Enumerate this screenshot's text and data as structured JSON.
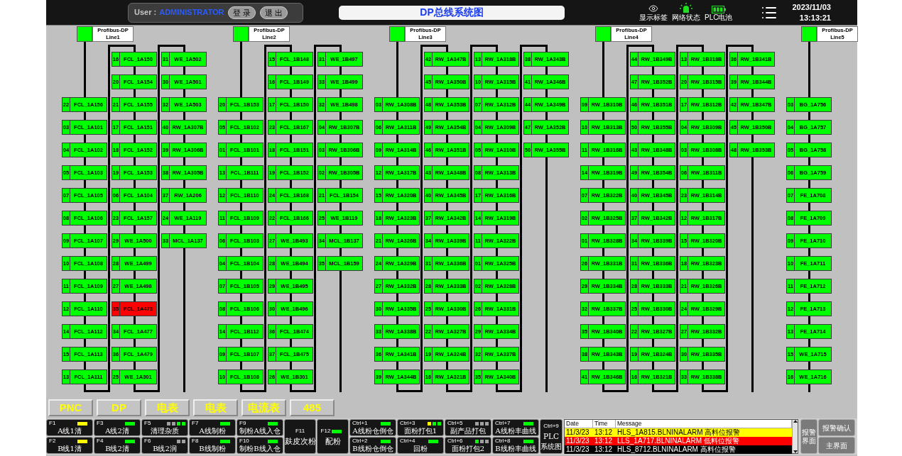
{
  "top_bar": {
    "user_label": "User :",
    "user_name": "ADMINISTRATOR",
    "buttons": [
      "登 录",
      "退 出"
    ],
    "title": "DP总线系统图",
    "status_icons": [
      {
        "kind": "eye",
        "label": "显示标签"
      },
      {
        "kind": "beacon",
        "label": "网络状态"
      },
      {
        "kind": "battery",
        "label": "PLC电池"
      }
    ],
    "date": "2023/11/03",
    "time": "13:13:21"
  },
  "lines": [
    {
      "title": "Profibus-DP",
      "name": "Line1",
      "columns": [
        {
          "kind": "trunk",
          "devices": [
            {
              "addr": "22",
              "tag": "FCL_1A156",
              "fault": false
            },
            {
              "addr": "03",
              "tag": "FCL_1A101",
              "fault": false
            },
            {
              "addr": "04",
              "tag": "FCL_1A102",
              "fault": false
            },
            {
              "addr": "05",
              "tag": "FCL_1A103",
              "fault": false
            },
            {
              "addr": "07",
              "tag": "FCL_1A105",
              "fault": false
            },
            {
              "addr": "08",
              "tag": "FCL_1A106",
              "fault": false
            },
            {
              "addr": "09",
              "tag": "FCL_1A107",
              "fault": false
            },
            {
              "addr": "10",
              "tag": "FCL_1A108",
              "fault": false
            },
            {
              "addr": "11",
              "tag": "FCL_1A109",
              "fault": false
            },
            {
              "addr": "12",
              "tag": "FCL_1A110",
              "fault": false
            },
            {
              "addr": "14",
              "tag": "FCL_1A112",
              "fault": false
            },
            {
              "addr": "15",
              "tag": "FCL_1A113",
              "fault": false
            },
            {
              "addr": "13",
              "tag": "FCL_1A111",
              "fault": false
            }
          ]
        },
        {
          "kind": "branch",
          "devices": [
            {
              "addr": "16",
              "tag": "FCL_1A150",
              "fault": false
            },
            {
              "addr": "20",
              "tag": "FCL_1A154",
              "fault": false
            },
            {
              "addr": "21",
              "tag": "FCL_1A155",
              "fault": false
            },
            {
              "addr": "17",
              "tag": "FCL_1A151",
              "fault": false
            },
            {
              "addr": "18",
              "tag": "FCL_1A152",
              "fault": false
            },
            {
              "addr": "19",
              "tag": "FCL_1A153",
              "fault": false
            },
            {
              "addr": "06",
              "tag": "FCL_1A104",
              "fault": false
            },
            {
              "addr": "23",
              "tag": "FCL_1A157",
              "fault": false
            },
            {
              "addr": "29",
              "tag": "WE_1A500",
              "fault": false
            },
            {
              "addr": "28",
              "tag": "WE_1A499",
              "fault": false
            },
            {
              "addr": "27",
              "tag": "WE_1A498",
              "fault": false
            },
            {
              "addr": "35",
              "tag": "FCL_1A478",
              "fault": true
            },
            {
              "addr": "34",
              "tag": "FCL_1A477",
              "fault": false
            },
            {
              "addr": "36",
              "tag": "FCL_1A479",
              "fault": false
            },
            {
              "addr": "25",
              "tag": "WE_1A301",
              "fault": false
            }
          ]
        },
        {
          "kind": "branch",
          "devices": [
            {
              "addr": "31",
              "tag": "WE_1A502",
              "fault": false
            },
            {
              "addr": "30",
              "tag": "WE_1A501",
              "fault": false
            },
            {
              "addr": "32",
              "tag": "WE_1A503",
              "fault": false
            },
            {
              "addr": "40",
              "tag": "RW_1A307B",
              "fault": false
            },
            {
              "addr": "39",
              "tag": "RW_1A306B",
              "fault": false
            },
            {
              "addr": "38",
              "tag": "RW_1A305B",
              "fault": false
            },
            {
              "addr": "37",
              "tag": "RW_1A206",
              "fault": false
            },
            {
              "addr": "24",
              "tag": "WE_1A119",
              "fault": false
            },
            {
              "addr": "33",
              "tag": "MCL_1A137",
              "fault": false
            }
          ]
        }
      ]
    },
    {
      "title": "Profibus-DP",
      "name": "Line2",
      "columns": [
        {
          "kind": "trunk",
          "devices": [
            {
              "addr": "20",
              "tag": "FCL_1B153",
              "fault": false
            },
            {
              "addr": "05",
              "tag": "FCL_1B102",
              "fault": false
            },
            {
              "addr": "01",
              "tag": "FCL_1B101",
              "fault": false
            },
            {
              "addr": "13",
              "tag": "FCL_1B111",
              "fault": false
            },
            {
              "addr": "12",
              "tag": "FCL_1B110",
              "fault": false
            },
            {
              "addr": "11",
              "tag": "FCL_1B109",
              "fault": false
            },
            {
              "addr": "06",
              "tag": "FCL_1B103",
              "fault": false
            },
            {
              "addr": "04",
              "tag": "FCL_1B104",
              "fault": false
            },
            {
              "addr": "07",
              "tag": "FCL_1B105",
              "fault": false
            },
            {
              "addr": "08",
              "tag": "FCL_1B106",
              "fault": false
            },
            {
              "addr": "14",
              "tag": "FCL_1B112",
              "fault": false
            },
            {
              "addr": "09",
              "tag": "FCL_1B107",
              "fault": false
            },
            {
              "addr": "10",
              "tag": "FCL_1B108",
              "fault": false
            }
          ]
        },
        {
          "kind": "branch",
          "devices": [
            {
              "addr": "15",
              "tag": "FCL_1B148",
              "fault": false
            },
            {
              "addr": "16",
              "tag": "FCL_1B149",
              "fault": false
            },
            {
              "addr": "17",
              "tag": "FCL_1B150",
              "fault": false
            },
            {
              "addr": "23",
              "tag": "FCL_1B167",
              "fault": false
            },
            {
              "addr": "18",
              "tag": "FCL_1B151",
              "fault": false
            },
            {
              "addr": "19",
              "tag": "FCL_1B152",
              "fault": false
            },
            {
              "addr": "24",
              "tag": "FCL_1B168",
              "fault": false
            },
            {
              "addr": "22",
              "tag": "FCL_1B166",
              "fault": false
            },
            {
              "addr": "27",
              "tag": "WE_1B493",
              "fault": false
            },
            {
              "addr": "28",
              "tag": "WE_1B494",
              "fault": false
            },
            {
              "addr": "29",
              "tag": "WE_1B495",
              "fault": false
            },
            {
              "addr": "30",
              "tag": "WE_1B496",
              "fault": false
            },
            {
              "addr": "36",
              "tag": "FCL_1B474",
              "fault": false
            },
            {
              "addr": "37",
              "tag": "FCL_1B475",
              "fault": false
            },
            {
              "addr": "26",
              "tag": "WE_1B301",
              "fault": false
            }
          ]
        },
        {
          "kind": "branch",
          "devices": [
            {
              "addr": "31",
              "tag": "WE_1B497",
              "fault": false
            },
            {
              "addr": "33",
              "tag": "WE_1B499",
              "fault": false
            },
            {
              "addr": "32",
              "tag": "WE_1B498",
              "fault": false
            },
            {
              "addr": "04",
              "tag": "RW_1B307B",
              "fault": false
            },
            {
              "addr": "03",
              "tag": "RW_1B306B",
              "fault": false
            },
            {
              "addr": "02",
              "tag": "RW_1B305B",
              "fault": false
            },
            {
              "addr": "21",
              "tag": "FCL_1B154",
              "fault": false
            },
            {
              "addr": "25",
              "tag": "WE_1B119",
              "fault": false
            },
            {
              "addr": "34",
              "tag": "MCL_1B137",
              "fault": false
            },
            {
              "addr": "35",
              "tag": "MCL_1B159",
              "fault": false
            }
          ]
        }
      ]
    },
    {
      "title": "Profibus-DP",
      "name": "Line3",
      "columns": [
        {
          "kind": "trunk",
          "devices": [
            {
              "addr": "03",
              "tag": "RW_1A308B",
              "fault": false
            },
            {
              "addr": "06",
              "tag": "RW_1A311B",
              "fault": false
            },
            {
              "addr": "09",
              "tag": "RW_1A314B",
              "fault": false
            },
            {
              "addr": "12",
              "tag": "RW_1A317B",
              "fault": false
            },
            {
              "addr": "15",
              "tag": "RW_1A320B",
              "fault": false
            },
            {
              "addr": "18",
              "tag": "RW_1A323B",
              "fault": false
            },
            {
              "addr": "21",
              "tag": "RW_1A326B",
              "fault": false
            },
            {
              "addr": "24",
              "tag": "RW_1A329B",
              "fault": false
            },
            {
              "addr": "27",
              "tag": "RW_1A332B",
              "fault": false
            },
            {
              "addr": "30",
              "tag": "RW_1A335B",
              "fault": false
            },
            {
              "addr": "33",
              "tag": "RW_1A338B",
              "fault": false
            },
            {
              "addr": "36",
              "tag": "RW_1A341B",
              "fault": false
            },
            {
              "addr": "39",
              "tag": "RW_1A344B",
              "fault": false
            }
          ]
        },
        {
          "kind": "branch",
          "devices": [
            {
              "addr": "42",
              "tag": "RW_1A347B",
              "fault": false
            },
            {
              "addr": "45",
              "tag": "RW_1A350B",
              "fault": false
            },
            {
              "addr": "48",
              "tag": "RW_1A353B",
              "fault": false
            },
            {
              "addr": "49",
              "tag": "RW_1A354B",
              "fault": false
            },
            {
              "addr": "46",
              "tag": "RW_1A351B",
              "fault": false
            },
            {
              "addr": "43",
              "tag": "RW_1A348B",
              "fault": false
            },
            {
              "addr": "40",
              "tag": "RW_1A345B",
              "fault": false
            },
            {
              "addr": "37",
              "tag": "RW_1A342B",
              "fault": false
            },
            {
              "addr": "34",
              "tag": "RW_1A339B",
              "fault": false
            },
            {
              "addr": "31",
              "tag": "RW_1A336B",
              "fault": false
            },
            {
              "addr": "28",
              "tag": "RW_1A333B",
              "fault": false
            },
            {
              "addr": "25",
              "tag": "RW_1A330B",
              "fault": false
            },
            {
              "addr": "22",
              "tag": "RW_1A327B",
              "fault": false
            },
            {
              "addr": "19",
              "tag": "RW_1A324B",
              "fault": false
            },
            {
              "addr": "16",
              "tag": "RW_1A321B",
              "fault": false
            }
          ]
        },
        {
          "kind": "branch",
          "devices": [
            {
              "addr": "13",
              "tag": "RW_1A318B",
              "fault": false
            },
            {
              "addr": "10",
              "tag": "RW_1A315B",
              "fault": false
            },
            {
              "addr": "07",
              "tag": "RW_1A312B",
              "fault": false
            },
            {
              "addr": "04",
              "tag": "RW_1A309B",
              "fault": false
            },
            {
              "addr": "05",
              "tag": "RW_1A310B",
              "fault": false
            },
            {
              "addr": "08",
              "tag": "RW_1A313B",
              "fault": false
            },
            {
              "addr": "17",
              "tag": "RW_1A316B",
              "fault": false
            },
            {
              "addr": "14",
              "tag": "RW_1A319B",
              "fault": false
            },
            {
              "addr": "11",
              "tag": "RW_1A322B",
              "fault": false
            },
            {
              "addr": "01",
              "tag": "RW_1A325B",
              "fault": false
            },
            {
              "addr": "02",
              "tag": "RW_1A328B",
              "fault": false
            },
            {
              "addr": "26",
              "tag": "RW_1A331B",
              "fault": false
            },
            {
              "addr": "29",
              "tag": "RW_1A334B",
              "fault": false
            },
            {
              "addr": "32",
              "tag": "RW_1A337B",
              "fault": false
            },
            {
              "addr": "35",
              "tag": "RW_1A340B",
              "fault": false
            }
          ]
        },
        {
          "kind": "branch",
          "devices": [
            {
              "addr": "38",
              "tag": "RW_1A343B",
              "fault": false
            },
            {
              "addr": "41",
              "tag": "RW_1A346B",
              "fault": false
            },
            {
              "addr": "44",
              "tag": "RW_1A349B",
              "fault": false
            },
            {
              "addr": "47",
              "tag": "RW_1A352B",
              "fault": false
            },
            {
              "addr": "50",
              "tag": "RW_1A355B",
              "fault": false
            }
          ]
        }
      ]
    },
    {
      "title": "Profibus-DP",
      "name": "Line4",
      "columns": [
        {
          "kind": "trunk",
          "devices": [
            {
              "addr": "09",
              "tag": "RW_1B310B",
              "fault": false
            },
            {
              "addr": "10",
              "tag": "RW_1B313B",
              "fault": false
            },
            {
              "addr": "11",
              "tag": "RW_1B316B",
              "fault": false
            },
            {
              "addr": "14",
              "tag": "RW_1B319B",
              "fault": false
            },
            {
              "addr": "07",
              "tag": "RW_1B322B",
              "fault": false
            },
            {
              "addr": "02",
              "tag": "RW_1B325B",
              "fault": false
            },
            {
              "addr": "01",
              "tag": "RW_1B328B",
              "fault": false
            },
            {
              "addr": "26",
              "tag": "RW_1B331B",
              "fault": false
            },
            {
              "addr": "29",
              "tag": "RW_1B334B",
              "fault": false
            },
            {
              "addr": "32",
              "tag": "RW_1B337B",
              "fault": false
            },
            {
              "addr": "35",
              "tag": "RW_1B340B",
              "fault": false
            },
            {
              "addr": "38",
              "tag": "RW_1B343B",
              "fault": false
            },
            {
              "addr": "41",
              "tag": "RW_1B346B",
              "fault": false
            }
          ]
        },
        {
          "kind": "branch",
          "devices": [
            {
              "addr": "44",
              "tag": "RW_1B349B",
              "fault": false
            },
            {
              "addr": "47",
              "tag": "RW_1B352B",
              "fault": false
            },
            {
              "addr": "46",
              "tag": "RW_1B351B",
              "fault": false
            },
            {
              "addr": "50",
              "tag": "RW_1B355B",
              "fault": false
            },
            {
              "addr": "43",
              "tag": "RW_1B348B",
              "fault": false
            },
            {
              "addr": "49",
              "tag": "RW_1B354B",
              "fault": false
            },
            {
              "addr": "40",
              "tag": "RW_1B345B",
              "fault": false
            },
            {
              "addr": "37",
              "tag": "RW_1B342B",
              "fault": false
            },
            {
              "addr": "34",
              "tag": "RW_1B339B",
              "fault": false
            },
            {
              "addr": "31",
              "tag": "RW_1B336B",
              "fault": false
            },
            {
              "addr": "28",
              "tag": "RW_1B333B",
              "fault": false
            },
            {
              "addr": "25",
              "tag": "RW_1B330B",
              "fault": false
            },
            {
              "addr": "22",
              "tag": "RW_1B327B",
              "fault": false
            },
            {
              "addr": "19",
              "tag": "RW_1B324B",
              "fault": false
            },
            {
              "addr": "16",
              "tag": "RW_1B321B",
              "fault": false
            }
          ]
        },
        {
          "kind": "branch",
          "devices": [
            {
              "addr": "13",
              "tag": "RW_1B318B",
              "fault": false
            },
            {
              "addr": "20",
              "tag": "RW_1B315B",
              "fault": false
            },
            {
              "addr": "17",
              "tag": "RW_1B312B",
              "fault": false
            },
            {
              "addr": "04",
              "tag": "RW_1B309B",
              "fault": false
            },
            {
              "addr": "03",
              "tag": "RW_1B308B",
              "fault": false
            },
            {
              "addr": "06",
              "tag": "RW_1B311B",
              "fault": false
            },
            {
              "addr": "23",
              "tag": "RW_1B314B",
              "fault": false
            },
            {
              "addr": "12",
              "tag": "RW_1B317B",
              "fault": false
            },
            {
              "addr": "15",
              "tag": "RW_1B320B",
              "fault": false
            },
            {
              "addr": "18",
              "tag": "RW_1B323B",
              "fault": false
            },
            {
              "addr": "21",
              "tag": "RW_1B326B",
              "fault": false
            },
            {
              "addr": "24",
              "tag": "RW_1B329B",
              "fault": false
            },
            {
              "addr": "27",
              "tag": "RW_1B332B",
              "fault": false
            },
            {
              "addr": "30",
              "tag": "RW_1B335B",
              "fault": false
            },
            {
              "addr": "33",
              "tag": "RW_1B338B",
              "fault": false
            }
          ]
        },
        {
          "kind": "branch",
          "devices": [
            {
              "addr": "36",
              "tag": "RW_1B341B",
              "fault": false
            },
            {
              "addr": "39",
              "tag": "RW_1B344B",
              "fault": false
            },
            {
              "addr": "42",
              "tag": "RW_1B347B",
              "fault": false
            },
            {
              "addr": "45",
              "tag": "RW_1B350B",
              "fault": false
            },
            {
              "addr": "48",
              "tag": "RW_1B353B",
              "fault": false
            }
          ]
        }
      ]
    },
    {
      "title": "Profibus-DP",
      "name": "Line5",
      "columns": [
        {
          "kind": "trunk",
          "devices": [
            {
              "addr": "03",
              "tag": "BG_1A756",
              "fault": false
            },
            {
              "addr": "04",
              "tag": "BG_1A757",
              "fault": false
            },
            {
              "addr": "05",
              "tag": "BG_1A758",
              "fault": false
            },
            {
              "addr": "06",
              "tag": "BG_1A759",
              "fault": false
            },
            {
              "addr": "07",
              "tag": "FE_1A708",
              "fault": false
            },
            {
              "addr": "08",
              "tag": "FE_1A709",
              "fault": false
            },
            {
              "addr": "09",
              "tag": "FE_1A710",
              "fault": false
            },
            {
              "addr": "10",
              "tag": "FE_1A711",
              "fault": false
            },
            {
              "addr": "11",
              "tag": "FE_1A712",
              "fault": false
            },
            {
              "addr": "12",
              "tag": "FE_1A713",
              "fault": false
            },
            {
              "addr": "13",
              "tag": "FE_1A714",
              "fault": false
            },
            {
              "addr": "15",
              "tag": "WE_1A715",
              "fault": false
            },
            {
              "addr": "16",
              "tag": "WE_1A716",
              "fault": false
            }
          ]
        }
      ]
    }
  ],
  "nav_buttons": [
    "PNC",
    "DP",
    "电表",
    "电表",
    "电流表",
    "485"
  ],
  "function_keys": [
    {
      "kind": "pair",
      "keys": [
        {
          "key": "F1",
          "label": "A线1清",
          "indicators": [
            {
              "color": "#ffff00"
            }
          ]
        },
        {
          "key": "F2",
          "label": "B线1清",
          "indicators": [
            {
              "color": "#ffff00"
            }
          ]
        }
      ]
    },
    {
      "kind": "pair",
      "keys": [
        {
          "key": "F3",
          "label": "A线2清",
          "indicators": [
            {
              "color": "#00ff00"
            }
          ]
        },
        {
          "key": "F4",
          "label": "B线2清",
          "indicators": [
            {
              "color": "#00ff00"
            }
          ]
        }
      ]
    },
    {
      "kind": "pair",
      "keys": [
        {
          "key": "F5",
          "label": "清理杂质",
          "indicators": [
            {
              "color": "#a0a0a0"
            },
            {
              "color": "#a0a0a0"
            },
            {
              "color": "#00ff00"
            },
            {
              "color": "#00ff00"
            }
          ]
        },
        {
          "key": "F6",
          "label": "B线2润",
          "indicators": [
            {
              "color": "#a0a0a0"
            },
            {
              "color": "#a0a0a0"
            }
          ]
        }
      ]
    },
    {
      "kind": "pair",
      "keys": [
        {
          "key": "F7",
          "label": "A线制粉",
          "indicators": [
            {
              "color": "#00ff00"
            }
          ]
        },
        {
          "key": "F8",
          "label": "B线制粉",
          "indicators": [
            {
              "color": "#00ff00"
            }
          ]
        }
      ]
    },
    {
      "kind": "pair",
      "keys": [
        {
          "key": "F9",
          "label": "制粉A线入仓",
          "indicators": [
            {
              "color": "#00ff00"
            }
          ]
        },
        {
          "key": "F10",
          "label": "制粉B线入仓",
          "indicators": [
            {
              "color": "#00ff00"
            }
          ]
        }
      ]
    },
    {
      "kind": "tall",
      "keys": [
        {
          "key": "F11",
          "label": "麸皮次粉"
        }
      ]
    },
    {
      "kind": "tall",
      "keys": [
        {
          "key": "F12",
          "label": "配粉",
          "indicators": [
            {
              "color": "#00ff00"
            }
          ]
        }
      ]
    },
    {
      "kind": "pair",
      "keys": [
        {
          "key": "Ctrl+1",
          "label": "A线粉仓倒仓",
          "indicators": [
            {
              "color": "#00ff00"
            }
          ]
        },
        {
          "key": "Ctrl+2",
          "label": "B线粉仓倒仓",
          "indicators": [
            {
              "color": "#00ff00"
            }
          ]
        }
      ]
    },
    {
      "kind": "pair",
      "keys": [
        {
          "key": "Ctrl+3",
          "label": "面粉打包1",
          "indicators": [
            {
              "color": "#ffff00"
            },
            {
              "color": "#00ff00"
            },
            {
              "color": "#00ff00"
            }
          ]
        },
        {
          "key": "Ctrl+4",
          "label": "回粉",
          "indicators": [
            {
              "color": "#00ff00"
            }
          ]
        }
      ]
    },
    {
      "kind": "pair",
      "keys": [
        {
          "key": "Ctrl+5",
          "label": "副产品打包",
          "indicators": [
            {
              "color": "#a0a0a0"
            },
            {
              "color": "#a0a0a0"
            },
            {
              "color": "#a0a0a0"
            }
          ]
        },
        {
          "key": "Ctrl+6",
          "label": "面粉打包2",
          "indicators": [
            {
              "color": "#00ff00"
            },
            {
              "color": "#a0a0a0"
            },
            {
              "color": "#a0a0a0"
            }
          ]
        }
      ]
    },
    {
      "kind": "pair",
      "keys": [
        {
          "key": "Ctrl+7",
          "label": "A线粉丰曲线",
          "indicators": [
            {
              "color": "#00ff00"
            }
          ]
        },
        {
          "key": "Ctrl+8",
          "label": "B线粉丰曲线",
          "indicators": [
            {
              "color": "#00ff00"
            }
          ]
        }
      ]
    },
    {
      "kind": "system",
      "keys": [
        {
          "key": "Ctrl+9",
          "label": "PLC",
          "sublabel": "系统图"
        }
      ]
    }
  ],
  "alarms": {
    "columns": [
      "Date",
      "Time",
      "Message"
    ],
    "rows": [
      {
        "date": "11/3/23",
        "time": "13:12",
        "message": "HLS_1A815.BLNINALARM 高料位报警",
        "color": "#ffff00"
      },
      {
        "date": "11/3/23",
        "time": "13:12",
        "message": "LLS_1A717.BLNINALARM 低料位报警",
        "color": "#ff0000"
      },
      {
        "date": "11/3/23",
        "time": "13:12",
        "message": "HLS_8712.BLNINALARM 高料位报警",
        "color": "#000000"
      }
    ]
  },
  "alarm_buttons": {
    "tall": "报警界面",
    "stacked": [
      "报警确认",
      "主界面"
    ]
  }
}
